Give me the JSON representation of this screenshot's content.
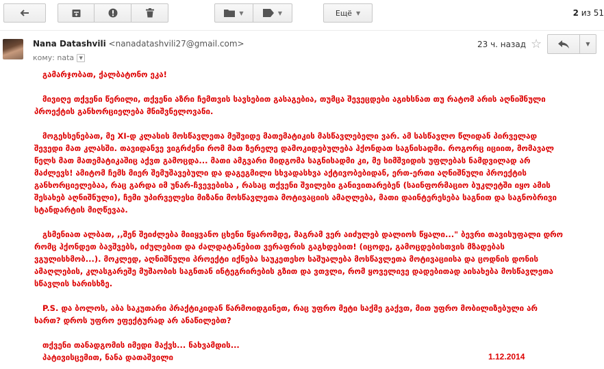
{
  "toolbar": {
    "more_label": "Ещё",
    "pager_current": "2",
    "pager_rest": " из 51"
  },
  "header": {
    "sender_name": "Nana Datashvili",
    "sender_email": "<nanadatashvili27@gmail.com>",
    "to_label": "кому: nata",
    "time": "23 ч. назад"
  },
  "message": {
    "greeting": "გამარჯობათ, ქალბატონო ეკა!",
    "p1": "მივიღე თქვენი წერილი, თქვენი  აზრი ჩემთვის სავსებით გასაგებია, თუმცა  შევეცდები აგიხსნათ თუ რატომ არის აღნიშნული პროექტის განხორციელება მნიშვნელოვანი.",
    "p2": "მოგეხსენებათ, მე   XI-დ  კლასის  მოსწავლეთა  მეშვიდე  მათემატიკის მასწავლებელი ვარ. ამ სასწავლო წლიდან პირველად შევედი მათ კლასში.  თავიდანვე ვიგრძენი რომ მათ ზერელე დამოკიდებულება ჰქონდათ საგნისადმი. როგორც იციით, მომავალ წელს მათ მათემატიკაშიც აქვთ გამოცდა... მათი ამგვარი მიდგომა საგნისადმი კი,  მე სიმშვიდის უფლებას ნამდვილად არ მაძლევს!  ამიტომ ჩემს მიერ შემუშავებული და დაგეგმილი სხვადასხვა აქტივობებიდან, ერთ-ერთი აღნიშნული პროექტის განხორციელებაა, რაც გარდა იმ უნარ-ჩვევებისა , რასაც თქვენი შვილები განივითარებენ (საინფორმაციო ბუკლეტში იყო ამის შესახებ აღნიშნული), ჩემი უპირველესი მიზანი მოსწავლეთა მოტივაციის ამაღლება, მათი დაინტერესება საგნით და საგნობრივი სტანდარტის მიღწევაა.",
    "p3": "გსმენიათ ალბათ, ,,შენ შეიძლება  მიიყვანო ცხენი წყარომდე, მაგრამ ვერ აიძულებ  დალიოს წყალი...\" ბევრი თავისუფალი დრო რომც ჰქონდეთ ბავშვებს, იძულებით და ძალდატანებით ვერაფრის გაგხდებით! (იცოდე, გამოცდებისთვის  მზადებას ვგულისხმობ...). მოკლედ, აღნიშნული პროექტი იქნება საუკეთესო საშუალება მოსწავლეთა მოტივაციისა და ცოდნის დონის ამაღლების,   კლასგარეშე მუშაობის   საგნთან ინტეგრირების გზით  და ვთვლი, რომ ყოველივე დადებითად აისახება მოსწავლეთა სწავლის ხარისხზე.",
    "p4": "P.S. და ბოლოს, აბა საკუთარი პრაქტიკიდან წარმოიდგინეთ, რაც უფრო მეტი საქმე გაქვთ, მით უფრო მობილიზებული არ ხართ? დროს უფრო ეფექტურად არ ანაწილებთ?",
    "sign1": "თქვენი თანადგომის იმედი მაქვს... ნახვამდის...",
    "sign2": "პატივისცემით, ნანა დათაშვილი",
    "date": "1.12.2014"
  },
  "icons": {
    "back": "back-arrow-icon",
    "archive": "archive-icon",
    "spam": "report-spam-icon",
    "delete": "trash-icon",
    "move": "folder-icon",
    "labels": "label-tag-icon",
    "star": "star-icon",
    "reply": "reply-icon",
    "more": "dropdown-arrow-icon"
  },
  "colors": {
    "message_text": "#dd0000",
    "toolbar_bg": "#f5f5f5",
    "border": "#c6c6c6"
  }
}
